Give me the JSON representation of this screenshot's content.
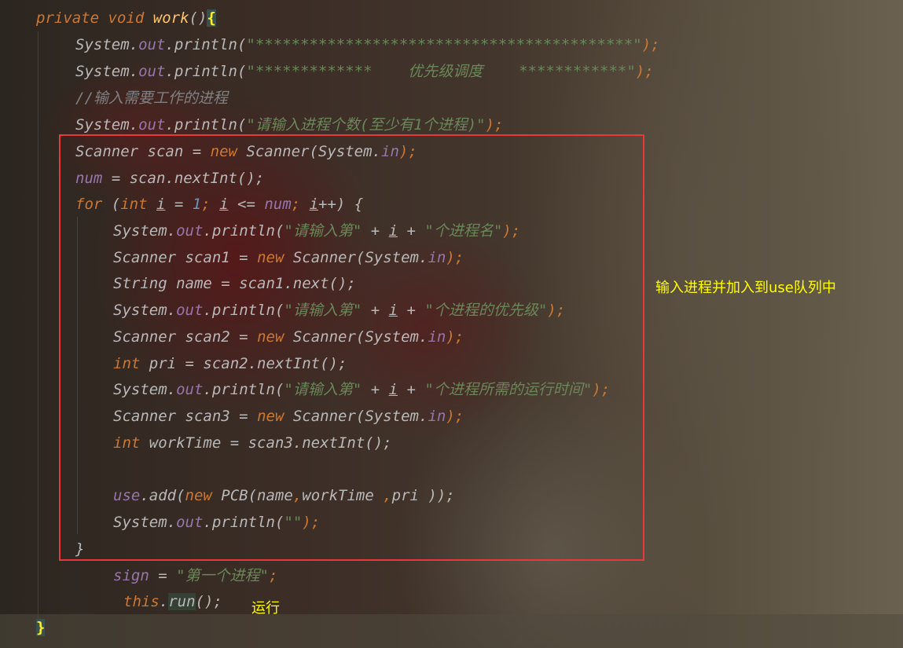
{
  "code": {
    "method_signature": {
      "private": "private",
      "void": "void",
      "name": "work",
      "parens": "()",
      "open_brace": "{"
    },
    "sysout": {
      "system": "System",
      "dot": ".",
      "out": "out",
      "println": "println",
      "open": "(",
      "close": ");"
    },
    "line2_str": "\"******************************************\"",
    "line3_str": "\"*************    优先级调度    ************\"",
    "line4_comment": "//输入需要工作的进程",
    "line5_str": "\"请输入进程个数(至少有1个进程)\"",
    "scanner_line": {
      "type": "Scanner",
      "var": "scan",
      "eq": " = ",
      "new": "new",
      "ctor": "Scanner(System.",
      "in": "in",
      "end": ");"
    },
    "num_line": {
      "num": "num",
      "rest": " = scan.nextInt();"
    },
    "for_line": {
      "for": "for",
      "open": " (",
      "int": "int",
      "i": "i",
      "init": " = ",
      "one": "1",
      "semi": "; ",
      "le": " <= ",
      "num": "num",
      "inc": "++) {"
    },
    "loop_lines": {
      "p1_str1": "\"请输入第\"",
      "plus": " + ",
      "p1_str2": "\"个进程名\"",
      "scan1": "scan1",
      "name_decl": "String name = scan1.next();",
      "p2_str2": "\"个进程的优先级\"",
      "scan2": "scan2",
      "pri_decl": " pri = scan2.nextInt();",
      "p3_str2": "\"个进程所需的运行时间\"",
      "scan3": "scan3",
      "worktime_decl": " workTime = scan3.nextInt();",
      "use": "use",
      "add": ".add(",
      "pcb": " PCB(name",
      "comma": ",",
      "worktime_arg": "workTime ",
      "pri_arg": "pri ));",
      "empty_str": "\"\""
    },
    "close_loop": "}",
    "sign_line": {
      "sign": "sign",
      "eq": " = ",
      "str": "\"第一个进程\"",
      "semi": ";"
    },
    "run_line": {
      "this": "this",
      "dot": ".",
      "run": "run",
      "rest": "();"
    },
    "close_method": "}"
  },
  "annotations": {
    "box_label": "输入进程并加入到use队列中",
    "run_label": "运行"
  },
  "colors": {
    "keyword": "#cc7832",
    "method": "#ffc66d",
    "field": "#9876aa",
    "string": "#6a8759",
    "number": "#6897bb",
    "highlight_box": "#e8383b",
    "annotation_text": "#ffff00"
  }
}
